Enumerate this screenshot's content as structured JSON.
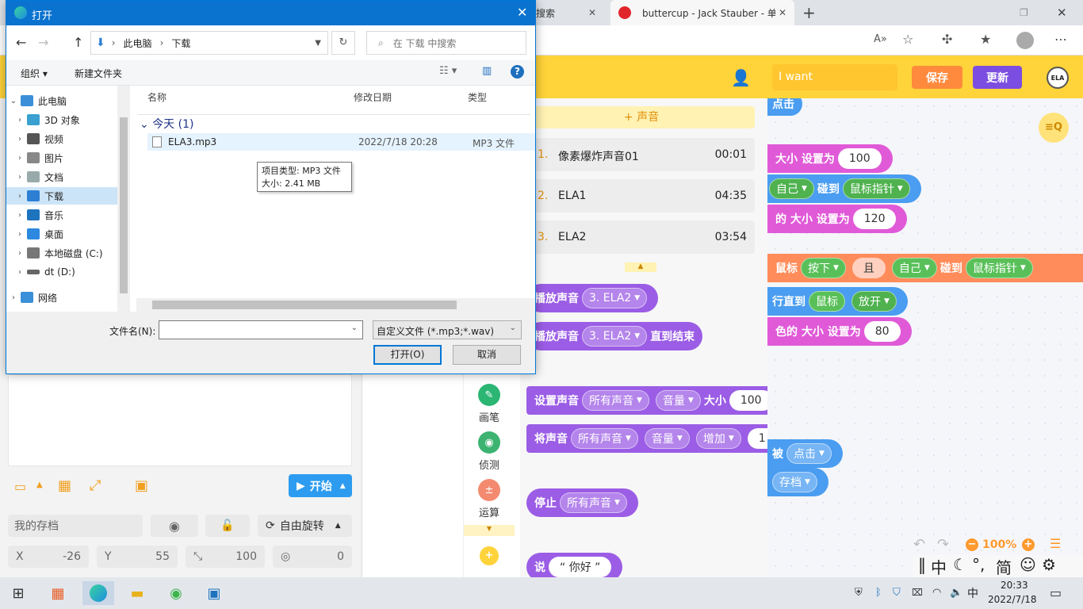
{
  "browser": {
    "tabs": [
      {
        "label": "搜索"
      },
      {
        "label": "buttercup - Jack Stauber - 单曲 ·"
      }
    ],
    "new_tab": "+"
  },
  "app": {
    "search_placeholder": "I want",
    "save_label": "保存",
    "update_label": "更新",
    "avatar_label": "ELA",
    "add_sound_label": "+ 声音",
    "sounds": [
      {
        "index": "1.",
        "name": "像素爆炸声音01",
        "duration": "00:01"
      },
      {
        "index": "2.",
        "name": "ELA1",
        "duration": "04:35"
      },
      {
        "index": "3.",
        "name": "ELA2",
        "duration": "03:54"
      }
    ],
    "blocks": {
      "play_sound": "播放声音",
      "sound_sel": "3. ELA2",
      "until_done": "直到结束",
      "set_sound": "设置声音",
      "all_sounds": "所有声音",
      "volume": "音量",
      "size": "大小",
      "val100": "100",
      "change_sound": "将声音",
      "increase": "增加",
      "val1": "1",
      "stop": "停止",
      "say": "说",
      "hello": "“ 你好 ”"
    },
    "categories": [
      {
        "label": "画笔",
        "color": "#2bb673"
      },
      {
        "label": "侦测",
        "color": "#3cb371"
      },
      {
        "label": "运算",
        "color": "#f38a6f"
      }
    ],
    "code": {
      "click": "点击",
      "set_size": "大小 设置为",
      "v100": "100",
      "self": "自己",
      "touch": "碰到",
      "mouse_ptr": "鼠标指针",
      "set_size2": "的 大小 设置为",
      "v120": "120",
      "mouse": "鼠标",
      "press": "按下",
      "and": "且",
      "until": "行直到",
      "release": "放开",
      "set_size3": "色的 大小 设置为",
      "v80": "80",
      "by": "被",
      "archive": "存档"
    },
    "stage": {
      "start_label": "开始",
      "my_archive": "我的存档",
      "rotate_label": "自由旋转",
      "x_label": "X",
      "x_val": "-26",
      "y_label": "Y",
      "y_val": "55",
      "size_val": "100",
      "dir_val": "0"
    },
    "zoom": "100%"
  },
  "dialog": {
    "title": "打开",
    "path": [
      "此电脑",
      "下载"
    ],
    "search_placeholder": "在 下载 中搜索",
    "organize": "组织 ▾",
    "new_folder": "新建文件夹",
    "tree": [
      {
        "label": "此电脑",
        "color": "#3b8fd8"
      },
      {
        "label": "3D 对象",
        "color": "#39a0d0"
      },
      {
        "label": "视频",
        "color": "#555"
      },
      {
        "label": "图片",
        "color": "#888"
      },
      {
        "label": "文档",
        "color": "#9aa"
      },
      {
        "label": "下载",
        "color": "#2d7fd3"
      },
      {
        "label": "音乐",
        "color": "#1e73be"
      },
      {
        "label": "桌面",
        "color": "#2d89e0"
      },
      {
        "label": "本地磁盘 (C:)",
        "color": "#777"
      },
      {
        "label": "dt (D:)",
        "color": "#666"
      },
      {
        "label": "网络",
        "color": "#3b8fd8"
      }
    ],
    "columns": {
      "name": "名称",
      "date": "修改日期",
      "type": "类型"
    },
    "group": "今天 (1)",
    "file": {
      "name": "ELA3.mp3",
      "date": "2022/7/18 20:28",
      "type": "MP3 文件"
    },
    "tooltip": {
      "line1": "项目类型: MP3 文件",
      "line2": "大小: 2.41 MB"
    },
    "filename_label": "文件名(N):",
    "filetype": "自定义文件 (*.mp3;*.wav)",
    "open_label": "打开(O)",
    "cancel_label": "取消"
  },
  "taskbar": {
    "ime": "中",
    "time": "20:33",
    "date": "2022/7/18"
  },
  "tray_ime": {
    "zh": "中",
    "simp": "简"
  }
}
